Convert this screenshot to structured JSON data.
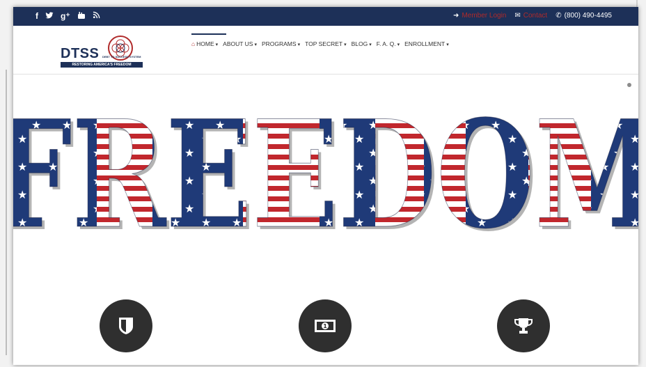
{
  "topbar": {
    "social_icons": [
      "facebook-icon",
      "twitter-icon",
      "google-plus-icon",
      "youtube-icon",
      "rss-icon"
    ],
    "social_glyphs": [
      "f",
      "🐦",
      "g⁺",
      "▶",
      "◉"
    ],
    "member_login": "Member Login",
    "contact": "Contact",
    "phone": "(800) 490-4495"
  },
  "logo": {
    "name": "DTSS",
    "subtitle": "DEBT TO SUCCESS SYSTEM",
    "tagline": "RESTORING AMERICA'S FREEDOM"
  },
  "nav": {
    "items": [
      {
        "label": "HOME"
      },
      {
        "label": "ABOUT US"
      },
      {
        "label": "PROGRAMS"
      },
      {
        "label": "TOP SECRET"
      },
      {
        "label": "BLOG"
      },
      {
        "label": "F. A. Q."
      },
      {
        "label": "ENROLLMENT"
      }
    ]
  },
  "hero": {
    "headline": "FREEDOM"
  },
  "features": [
    {
      "icon": "shield-icon"
    },
    {
      "icon": "money-icon"
    },
    {
      "icon": "trophy-icon"
    }
  ],
  "colors": {
    "navy": "#1d3058",
    "red": "#b02a2a",
    "flag_red": "#c1272d",
    "flag_blue": "#1f3a78",
    "circle": "#2f2f2f"
  }
}
